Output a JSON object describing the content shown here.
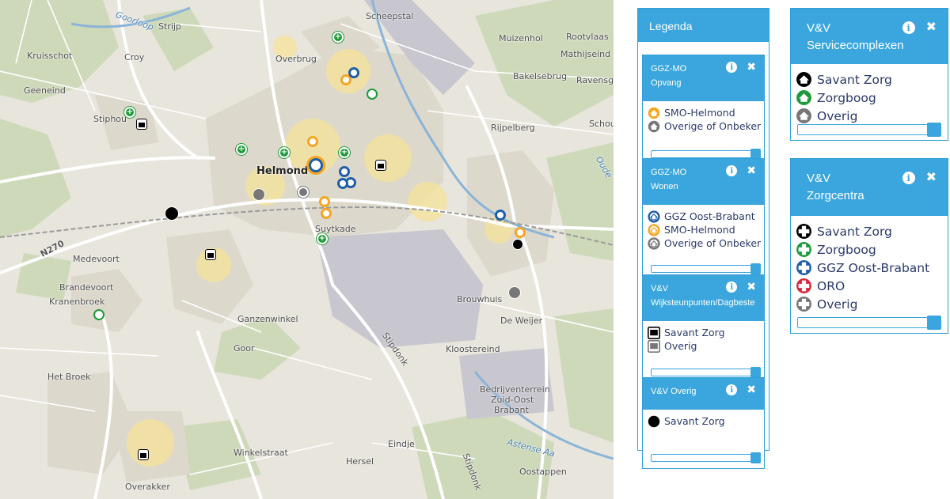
{
  "map": {
    "places": {
      "scheepstal": "Scheepstal",
      "strijp": "Strijp",
      "gooiloop": "Goorloop",
      "muizenhol": "Muizenhol",
      "rootvlaas": "Rootvlaas",
      "kruisschot": "Kruisschot",
      "croy": "Croy",
      "overbrug": "Overbrug",
      "mathijseind": "Mathijseind",
      "bakelsebrug": "Bakelsebrug",
      "ravensgat": "Ravensga",
      "geeneind": "Geeneind",
      "stiphout": "Stiphou",
      "rijpelberg": "Rijpelberg",
      "schoute": "Schou",
      "helmond": "Helmond",
      "n270": "N270",
      "suytkade": "Suytkade",
      "medevoort": "Medevoort",
      "brandevoort": "Brandevoort",
      "kranenbroek": "Kranenbroek",
      "brouwhuis": "Brouwhuis",
      "deweijer": "De Weijer",
      "ganzenwinkel": "Ganzenwinkel",
      "goor": "Goor",
      "stipdonk": "Stipdonk",
      "kloostereind": "Kloostereind",
      "hetbroek": "Het Broek",
      "bedrijventerrein": "Bedrijventerrein",
      "zuidoost": "Zuid-Oost",
      "brabant": "Brabant",
      "eindje": "Eindje",
      "winkelstraat": "Winkelstraat",
      "hersel": "Hersel",
      "astense": "Astense Aa",
      "overakker": "Overakker",
      "oostappen": "Oostappen",
      "stipdonk2": "Stipdonk",
      "oude": "Oude"
    }
  },
  "legend": {
    "title": "Legenda",
    "groups": [
      {
        "title_line1": "GGZ-MO",
        "title_line2": "Opvang",
        "items": [
          {
            "label": "SMO-Helmond",
            "color": "#f5a623",
            "icon": "house-circle-icon"
          },
          {
            "label": "Overige  of Onbekend",
            "color": "#777777",
            "icon": "house-circle-icon"
          }
        ]
      },
      {
        "title_line1": "GGZ-MO",
        "title_line2": "Wonen",
        "items": [
          {
            "label": "GGZ Oost-Brabant",
            "color": "#1f5fa8",
            "icon": "house-ring-icon"
          },
          {
            "label": "SMO-Helmond",
            "color": "#f5a623",
            "icon": "house-ring-icon"
          },
          {
            "label": "Overige  of Onbekend",
            "color": "#777777",
            "icon": "house-ring-icon"
          }
        ]
      },
      {
        "title_line1": "V&V",
        "title_line2": "Wijksteunpunten/Dagbeste",
        "items": [
          {
            "label": "Savant Zorg",
            "color": "#000000",
            "icon": "square-building-icon"
          },
          {
            "label": "Overig",
            "color": "#777777",
            "icon": "square-building-icon"
          }
        ]
      },
      {
        "title_line1": "V&V Overig",
        "title_line2": "",
        "items": [
          {
            "label": "Savant Zorg",
            "color": "#000000",
            "icon": "black-dot-icon"
          }
        ]
      }
    ],
    "right_groups": [
      {
        "title_line1": "V&V",
        "title_line2": "Servicecomplexen",
        "items": [
          {
            "label": "Savant Zorg",
            "color": "#000000",
            "icon": "house-circle-icon"
          },
          {
            "label": "Zorgboog",
            "color": "#1f9a3a",
            "icon": "house-circle-icon"
          },
          {
            "label": "Overig",
            "color": "#777777",
            "icon": "house-circle-icon"
          }
        ]
      },
      {
        "title_line1": "V&V",
        "title_line2": "Zorgcentra",
        "items": [
          {
            "label": "Savant Zorg",
            "color": "#000000",
            "icon": "cross-circle-icon"
          },
          {
            "label": "Zorgboog",
            "color": "#1f9a3a",
            "icon": "cross-circle-icon"
          },
          {
            "label": "GGZ Oost-Brabant",
            "color": "#1f5fa8",
            "icon": "cross-circle-icon"
          },
          {
            "label": "ORO",
            "color": "#d7263d",
            "icon": "cross-circle-icon"
          },
          {
            "label": "Overig",
            "color": "#777777",
            "icon": "cross-circle-icon"
          }
        ]
      }
    ],
    "opacity_slider_value": 1.0,
    "info_symbol": "i",
    "close_symbol": "✖"
  }
}
